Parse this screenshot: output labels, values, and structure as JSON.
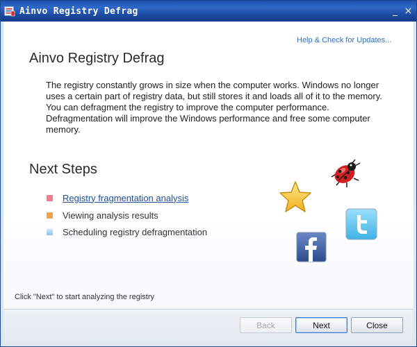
{
  "window": {
    "title": "Ainvo Registry Defrag",
    "minimize_glyph": "_",
    "close_glyph": "×"
  },
  "help_link": "Help & Check for Updates...",
  "header": {
    "title": "Ainvo Registry Defrag"
  },
  "description": "The registry constantly grows in size when the computer works. Windows no longer uses a certain part of registry data, but still stores it and loads all of it to the memory. You can defragment the registry to improve the computer performance. Defragmentation will improve the Windows performance and free some computer memory.",
  "next_steps": {
    "title": "Next Steps",
    "items": [
      {
        "label": "Registry fragmentation analysis",
        "bullet_color": "#f07f8e",
        "active": true
      },
      {
        "label": "Viewing analysis results",
        "bullet_color": "#f4a24a",
        "active": false
      },
      {
        "label": "Scheduling registry defragmentation",
        "bullet_color": "#a9d6f2",
        "active": false
      }
    ]
  },
  "icons": [
    "ladybug-icon",
    "star-icon",
    "twitter-icon",
    "facebook-icon"
  ],
  "status_text": "Click \"Next\" to start analyzing the registry",
  "buttons": {
    "back": "Back",
    "next": "Next",
    "close": "Close"
  },
  "colors": {
    "titlebar": "#1f4fa8",
    "link": "#2f6fb8",
    "twitter": "#5ec4ef",
    "facebook": "#3b5a98"
  }
}
